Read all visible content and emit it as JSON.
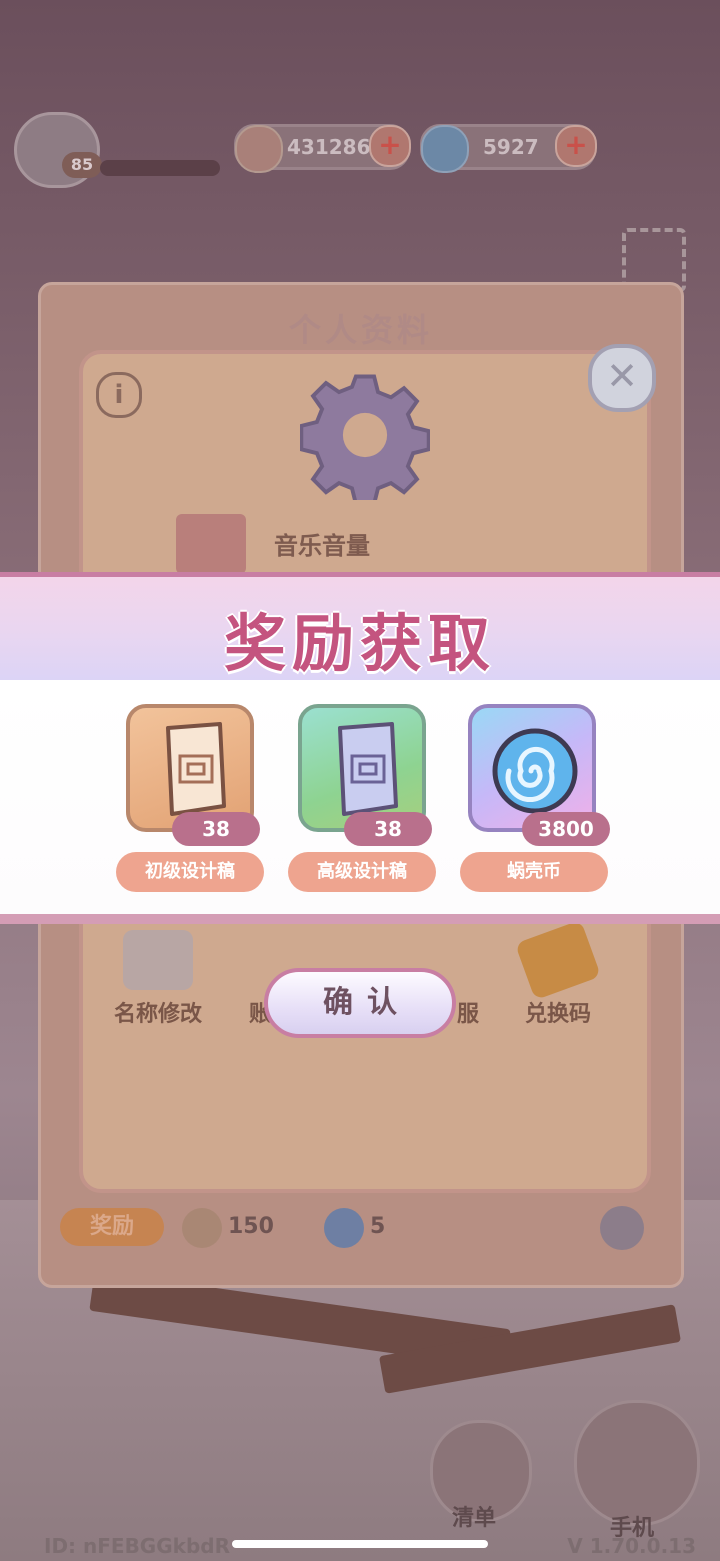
{
  "hud": {
    "level": "85",
    "shell_parts": "431286",
    "snail_coins": "5927",
    "plus": "+"
  },
  "settings_panel": {
    "title": "个人资料",
    "info_symbol": "i",
    "close_symbol": "✕",
    "music_volume_label": "音乐音量",
    "menu": [
      {
        "label": "名称修改"
      },
      {
        "label": "账"
      },
      {
        "label": "服"
      },
      {
        "label": "兑换码"
      }
    ],
    "reward_tag": "奖励",
    "reward_values": [
      "150",
      "5"
    ]
  },
  "reward_popup": {
    "title": "奖励获取",
    "items": [
      {
        "name": "初级设计稿",
        "count": "38",
        "icon": "scroll-blueprint-basic-icon"
      },
      {
        "name": "高级设计稿",
        "count": "38",
        "icon": "scroll-blueprint-advanced-icon"
      },
      {
        "name": "蜗壳币",
        "count": "3800",
        "icon": "snail-shell-coin-icon"
      }
    ],
    "confirm": "确认"
  },
  "bottom": {
    "player_id": "ID: nFEBGGkbdR",
    "version": "V 1.70.0.13",
    "list_label": "清单",
    "phone_label": "手机"
  },
  "colors": {
    "title_pink": "#c4547f",
    "accent_border": "#c87ea3",
    "label_salmon": "#eea48f",
    "count_badge": "#b9708c"
  }
}
